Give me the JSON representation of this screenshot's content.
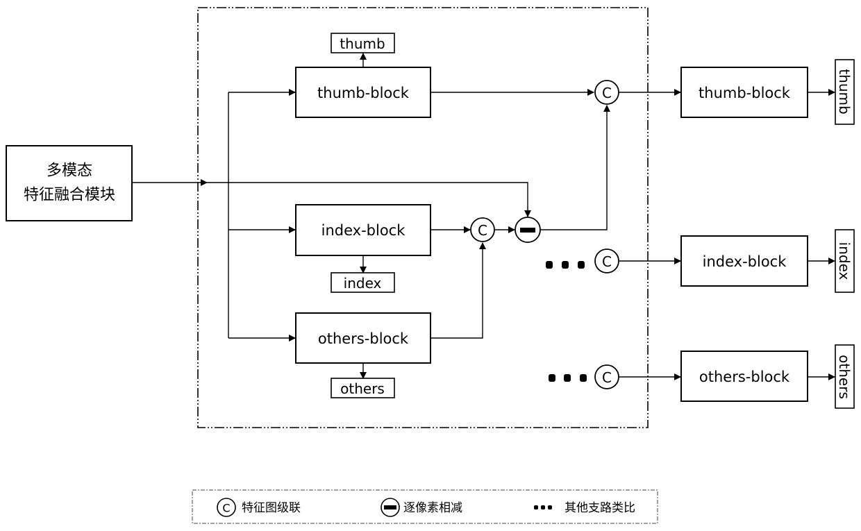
{
  "input_module": {
    "line1": "多模态",
    "line2": "特征融合模块"
  },
  "inner_blocks": {
    "thumb_block": "thumb-block",
    "index_block": "index-block",
    "others_block": "others-block"
  },
  "inner_outputs": {
    "thumb": "thumb",
    "index": "index",
    "others": "others"
  },
  "operators": {
    "concat_symbol": "C"
  },
  "right_blocks": {
    "thumb_block": "thumb-block",
    "index_block": "index-block",
    "others_block": "others-block"
  },
  "right_outputs": {
    "thumb": "thumb",
    "index": "index",
    "others": "others"
  },
  "legend": {
    "concat_label": "特征图级联",
    "subtract_label": "逐像素相减",
    "analogy_label": "其他支路类比"
  }
}
